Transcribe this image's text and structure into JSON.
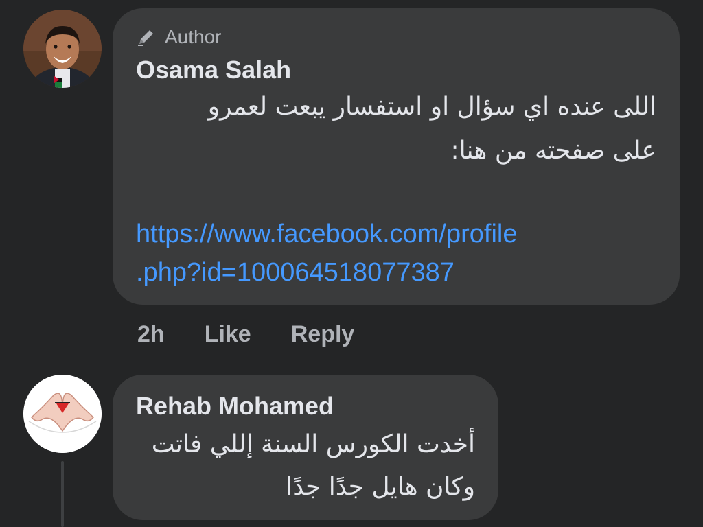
{
  "comment1": {
    "badge_label": "Author",
    "badge_icon": "pencil-icon",
    "author_name": "Osama Salah",
    "text_lines": [
      "اللى عنده اي سؤال او استفسار يبعت لعمرو",
      "على صفحته من هنا:"
    ],
    "link_lines": [
      "https://www.facebook.com/profile",
      ".php?id=100064518077387"
    ],
    "time": "2h",
    "like_label": "Like",
    "reply_label": "Reply"
  },
  "comment2": {
    "author_name": "Rehab Mohamed",
    "text_lines": [
      "أخدت الكورس السنة إللي فاتت",
      "وكان هايل جدًا جدًا"
    ]
  },
  "colors": {
    "background": "#242526",
    "bubble": "#3a3b3c",
    "primary_text": "#e4e6eb",
    "secondary_text": "#b0b3b8",
    "link": "#4599ff"
  }
}
